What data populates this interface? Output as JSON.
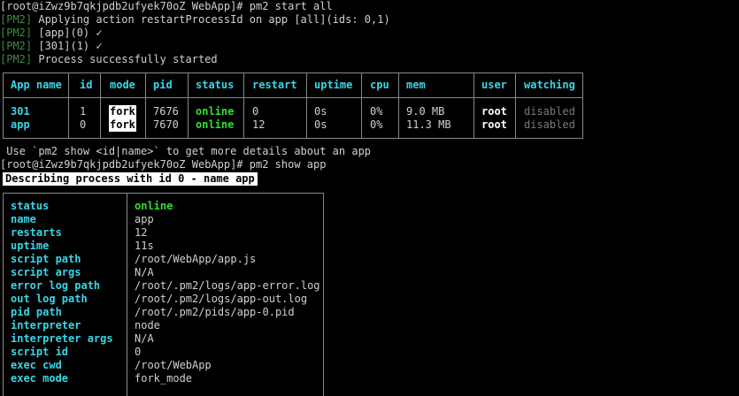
{
  "terminal": {
    "lines": [
      {
        "prompt": "[root@iZwz9b7qkjpdb2ufyek70oZ WebApp]# ",
        "command": "pm2 start all"
      },
      {
        "tag": "[PM2]",
        "text": " Applying action restartProcessId on app [all](ids: 0,1)"
      },
      {
        "tag": "[PM2]",
        "text": " [app](0) ✓"
      },
      {
        "tag": "[PM2]",
        "text": " [301](1) ✓"
      },
      {
        "tag": "[PM2]",
        "text": " Process successfully started"
      }
    ],
    "hint_line": " Use `pm2 show <id|name>` to get more details about an app",
    "prompt2": {
      "prompt": "[root@iZwz9b7qkjpdb2ufyek70oZ WebApp]# ",
      "command": "pm2 show app"
    },
    "describe_banner": "Describing process with id 0 - name app"
  },
  "process_table": {
    "headers": [
      "App name",
      "id",
      "mode",
      "pid",
      "status",
      "restart",
      "uptime",
      "cpu",
      "mem",
      "user",
      "watching"
    ],
    "rows": [
      {
        "name": "301",
        "id": "1",
        "mode": "fork",
        "pid": "7676",
        "status": "online",
        "restart": "0",
        "uptime": "0s",
        "cpu": "0%",
        "mem": "9.0 MB",
        "user": "root",
        "watching": "disabled"
      },
      {
        "name": "app",
        "id": "0",
        "mode": "fork",
        "pid": "7670",
        "status": "online",
        "restart": "12",
        "uptime": "0s",
        "cpu": "0%",
        "mem": "11.3 MB",
        "user": "root",
        "watching": "disabled"
      }
    ]
  },
  "describe_table": {
    "rows": [
      {
        "key": "status",
        "value": "online"
      },
      {
        "key": "name",
        "value": "app"
      },
      {
        "key": "restarts",
        "value": "12"
      },
      {
        "key": "uptime",
        "value": "11s"
      },
      {
        "key": "script path",
        "value": "/root/WebApp/app.js"
      },
      {
        "key": "script args",
        "value": "N/A"
      },
      {
        "key": "error log path",
        "value": "/root/.pm2/logs/app-error.log"
      },
      {
        "key": "out log path",
        "value": "/root/.pm2/logs/app-out.log"
      },
      {
        "key": "pid path",
        "value": "/root/.pm2/pids/app-0.pid"
      },
      {
        "key": "interpreter",
        "value": "node"
      },
      {
        "key": "interpreter args",
        "value": "N/A"
      },
      {
        "key": "script id",
        "value": "0"
      },
      {
        "key": "exec cwd",
        "value": "/root/WebApp"
      },
      {
        "key": "exec mode",
        "value": "fork_mode"
      }
    ]
  },
  "colors": {
    "background": "#000000",
    "text": "#d0d0d0",
    "pm2_tag": "#3d8c3d",
    "online": "#2fe02f",
    "header_cyan": "#39d6e6",
    "border": "#888888",
    "disabled": "#7a7a7a"
  }
}
